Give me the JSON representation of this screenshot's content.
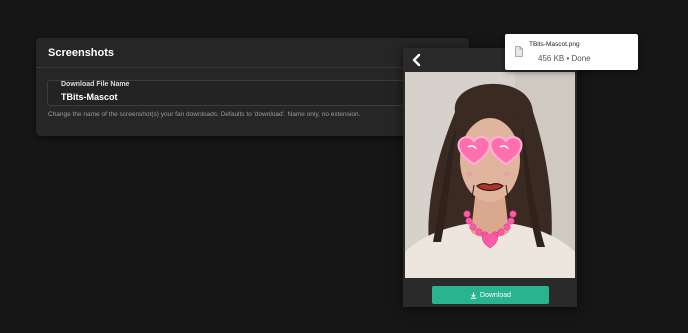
{
  "settings": {
    "title": "Screenshots",
    "field_label": "Download File Name",
    "field_value": "TBits-Mascot",
    "help_text": "Change the name of the screenshot(s) your fan downloads. Defaults to 'download'. Name only, no extension."
  },
  "preview": {
    "back_icon": "chevron-left-icon",
    "download_label": "Download",
    "download_icon": "download-icon",
    "button_color": "#27b48f"
  },
  "download_toast": {
    "filename": "TBits-Mascot.png",
    "status": "456 KB • Done",
    "file_icon": "file-icon"
  }
}
